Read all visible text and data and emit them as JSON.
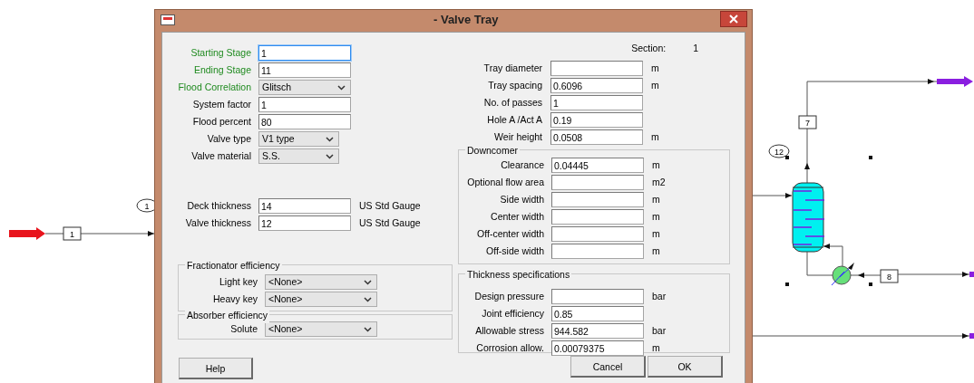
{
  "window": {
    "title": "- Valve Tray"
  },
  "left_fields": [
    {
      "label": "Starting Stage",
      "kind": "text",
      "value": "1",
      "required": true,
      "focused": true
    },
    {
      "label": "Ending Stage",
      "kind": "text",
      "value": "11",
      "required": true,
      "focused": false
    },
    {
      "label": "Flood Correlation",
      "kind": "select",
      "value": "Glitsch",
      "required": true,
      "focused": false
    },
    {
      "label": "System factor",
      "kind": "text",
      "value": "1",
      "required": false,
      "focused": false
    },
    {
      "label": "Flood percent",
      "kind": "text",
      "value": "80",
      "required": false,
      "focused": false
    },
    {
      "label": "Valve type",
      "kind": "select",
      "value": "V1 type",
      "required": false,
      "focused": false
    },
    {
      "label": "Valve material",
      "kind": "select",
      "value": "S.S.",
      "required": false,
      "focused": false
    }
  ],
  "thickness_gauge": [
    {
      "label": "Deck thickness",
      "value": "14",
      "unit": "US Std Gauge"
    },
    {
      "label": "Valve thickness",
      "value": "12",
      "unit": "US Std Gauge"
    }
  ],
  "fractionator": {
    "title": "Fractionator efficiency",
    "fields": [
      {
        "label": "Light key",
        "value": "<None>"
      },
      {
        "label": "Heavy key",
        "value": "<None>"
      }
    ]
  },
  "absorber": {
    "title": "Absorber efficiency",
    "fields": [
      {
        "label": "Solute",
        "value": "<None>"
      }
    ]
  },
  "section": {
    "label": "Section:",
    "value": "1"
  },
  "tray_fields": [
    {
      "label": "Tray diameter",
      "unit": "m"
    },
    {
      "label": "Tray spacing",
      "value": "0.6096",
      "unit": "m"
    },
    {
      "label": "No. of passes",
      "value": "1"
    },
    {
      "label": "Hole A /Act A",
      "value": "0.19"
    },
    {
      "label": "Weir height",
      "value": "0.0508",
      "unit": "m"
    }
  ],
  "downcomer": {
    "title": "Downcomer",
    "fields": [
      {
        "label": "Clearance",
        "value": "0.04445",
        "unit": "m"
      },
      {
        "label": "Optional flow area",
        "unit": "m2"
      },
      {
        "label": "Side width",
        "unit": "m"
      },
      {
        "label": "Center width",
        "unit": "m"
      },
      {
        "label": "Off-center width",
        "unit": "m"
      },
      {
        "label": "Off-side width",
        "unit": "m"
      }
    ]
  },
  "thickness_specifications": {
    "title": "Thickness specifications",
    "fields": [
      {
        "label": "Design pressure",
        "unit": "bar"
      },
      {
        "label": "Joint efficiency",
        "value": "0.85"
      },
      {
        "label": "Allowable stress",
        "value": "944.582",
        "unit": "bar"
      },
      {
        "label": "Corrosion allow.",
        "value": "0.00079375",
        "unit": "m"
      }
    ]
  },
  "buttons": [
    {
      "label": "Help"
    },
    {
      "label": "Cancel"
    },
    {
      "label": "OK"
    }
  ],
  "flowsheet": {
    "stream_tags": [
      "1",
      "7",
      "8"
    ],
    "unit_tags": [
      "1",
      "12"
    ]
  }
}
